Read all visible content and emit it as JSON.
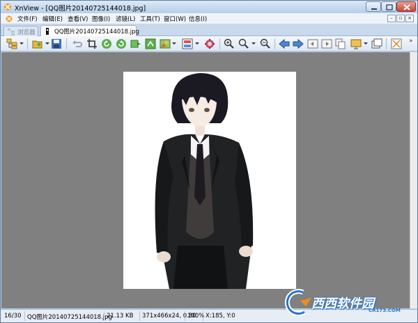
{
  "window": {
    "title": "XnView - [QQ图片20140725144018.jpg]"
  },
  "menu": {
    "items": [
      {
        "label": "文件(F)"
      },
      {
        "label": "编辑(E)"
      },
      {
        "label": "查看(V)"
      },
      {
        "label": "图像(I)"
      },
      {
        "label": "滤镜(L)"
      },
      {
        "label": "工具(T)"
      },
      {
        "label": "窗口(W)"
      },
      {
        "label": "信息(I)"
      }
    ]
  },
  "tabs": [
    {
      "label": "浏览器",
      "active": false
    },
    {
      "label": "QQ图片20140725144018.jpg",
      "active": true
    }
  ],
  "toolbar": {
    "icons": [
      "browser-icon",
      "open-icon",
      "save-icon",
      "undo-icon",
      "crop-icon",
      "rotate-left-icon",
      "rotate-right-icon",
      "flip-icon",
      "transform-icon",
      "image-effect-icon",
      "color-icon",
      "settings-gear-icon",
      "zoom-in-icon",
      "zoom-fit-icon",
      "zoom-out-icon",
      "previous-icon",
      "next-icon",
      "first-icon",
      "last-icon",
      "copy-icon",
      "slideshow-icon",
      "fullscreen-icon",
      "options-icon"
    ]
  },
  "status": {
    "index": "16/30",
    "filename": "QQ图片20140725144018.jpg",
    "filesize": "21.13 KB",
    "dimensions": "371x466x24, 0.80",
    "zoom": "100%",
    "cursor": "X:185, Y:0"
  },
  "watermark": {
    "text": "西西软件园",
    "subtext": "CR173.COM"
  },
  "colors": {
    "viewer_bg": "#808080",
    "frame": "#bcd5ee",
    "close_button": "#c8463a"
  }
}
